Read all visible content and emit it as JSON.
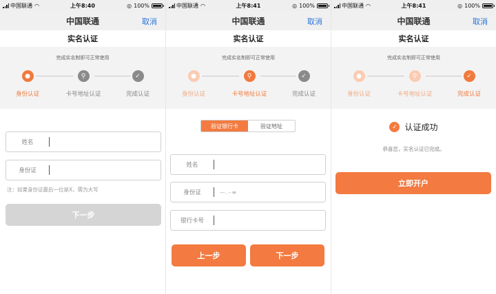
{
  "screens": [
    {
      "status": {
        "carrier": "中国联通",
        "time": "上午8:40",
        "battery": "100%"
      },
      "nav": {
        "title": "中国联通",
        "cancel": "取消"
      },
      "subtitle": "实名认证",
      "hint": "完成实名制即可正常使用",
      "steps": [
        {
          "label": "身份认证",
          "state": "active",
          "icon": "person-icon"
        },
        {
          "label": "卡号地址认证",
          "state": "todo",
          "icon": "location-pin-icon"
        },
        {
          "label": "完成认证",
          "state": "todo",
          "icon": "check-icon"
        }
      ],
      "fields": [
        {
          "label": "姓名",
          "value": ""
        },
        {
          "label": "身份证",
          "value": ""
        }
      ],
      "note": "注：如果身份证最后一位是X，需为大写",
      "next_button": "下一步"
    },
    {
      "status": {
        "carrier": "中国联通",
        "time": "上午8:41",
        "battery": "100%"
      },
      "nav": {
        "title": "中国联通",
        "cancel": "取消"
      },
      "subtitle": "实名认证",
      "hint": "完成实名制即可正常使用",
      "steps": [
        {
          "label": "身份认证",
          "state": "done",
          "icon": "person-icon"
        },
        {
          "label": "卡号地址认证",
          "state": "active",
          "icon": "location-pin-icon"
        },
        {
          "label": "完成认证",
          "state": "todo",
          "icon": "check-icon"
        }
      ],
      "tabs": [
        {
          "label": "验证银行卡",
          "selected": true
        },
        {
          "label": "验证地址",
          "selected": false
        }
      ],
      "fields": [
        {
          "label": "姓名",
          "value": ""
        },
        {
          "label": "身份证",
          "value": "—.–≡"
        },
        {
          "label": "银行卡号",
          "value": ""
        }
      ],
      "prev_button": "上一步",
      "next_button": "下一步"
    },
    {
      "status": {
        "carrier": "中国联通",
        "time": "上午8:41",
        "battery": "100%"
      },
      "nav": {
        "title": "中国联通",
        "cancel": "取消"
      },
      "subtitle": "实名认证",
      "hint": "完成实名制即可正常使用",
      "steps": [
        {
          "label": "身份认证",
          "state": "done",
          "icon": "person-icon"
        },
        {
          "label": "卡号地址认证",
          "state": "done",
          "icon": "location-pin-icon"
        },
        {
          "label": "完成认证",
          "state": "active",
          "icon": "check-icon"
        }
      ],
      "success_title": "认证成功",
      "success_sub": "恭喜您，实名认证已完成。",
      "open_button": "立即开户"
    }
  ],
  "colors": {
    "accent": "#f37a40",
    "accent_light": "#fbcbb2",
    "link": "#2a73d9",
    "pending": "#8a8a8a"
  }
}
